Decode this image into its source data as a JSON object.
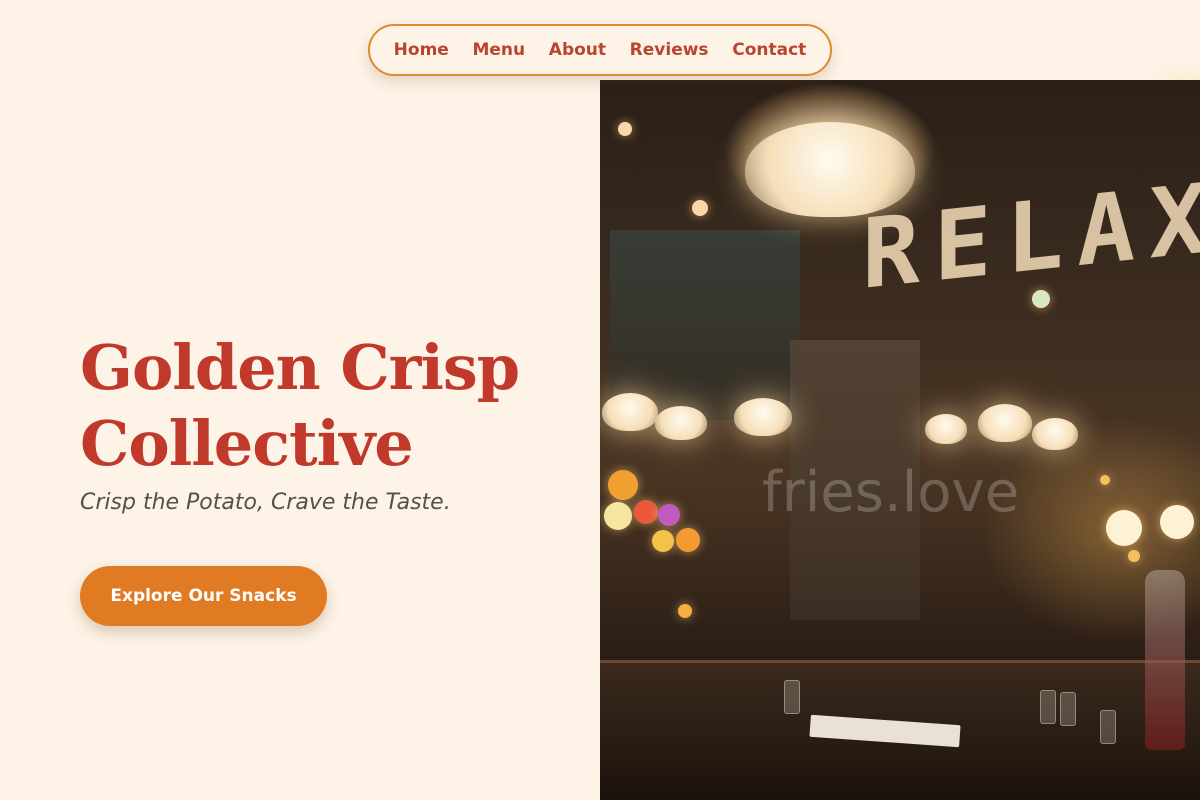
{
  "nav": {
    "items": [
      {
        "label": "Home"
      },
      {
        "label": "Menu"
      },
      {
        "label": "About"
      },
      {
        "label": "Reviews"
      },
      {
        "label": "Contact"
      }
    ]
  },
  "hero": {
    "title_line1": "Golden Crisp",
    "title_line2": "Collective",
    "tagline": "Crisp the Potato, Crave the Taste.",
    "cta_label": "Explore Our Snacks"
  },
  "photo": {
    "sign_text": "RELAX",
    "watermark": "fries.love"
  },
  "colors": {
    "background": "#fdf3e7",
    "accent": "#e07b24",
    "title": "#c0392b",
    "nav_text": "#b8452e"
  }
}
